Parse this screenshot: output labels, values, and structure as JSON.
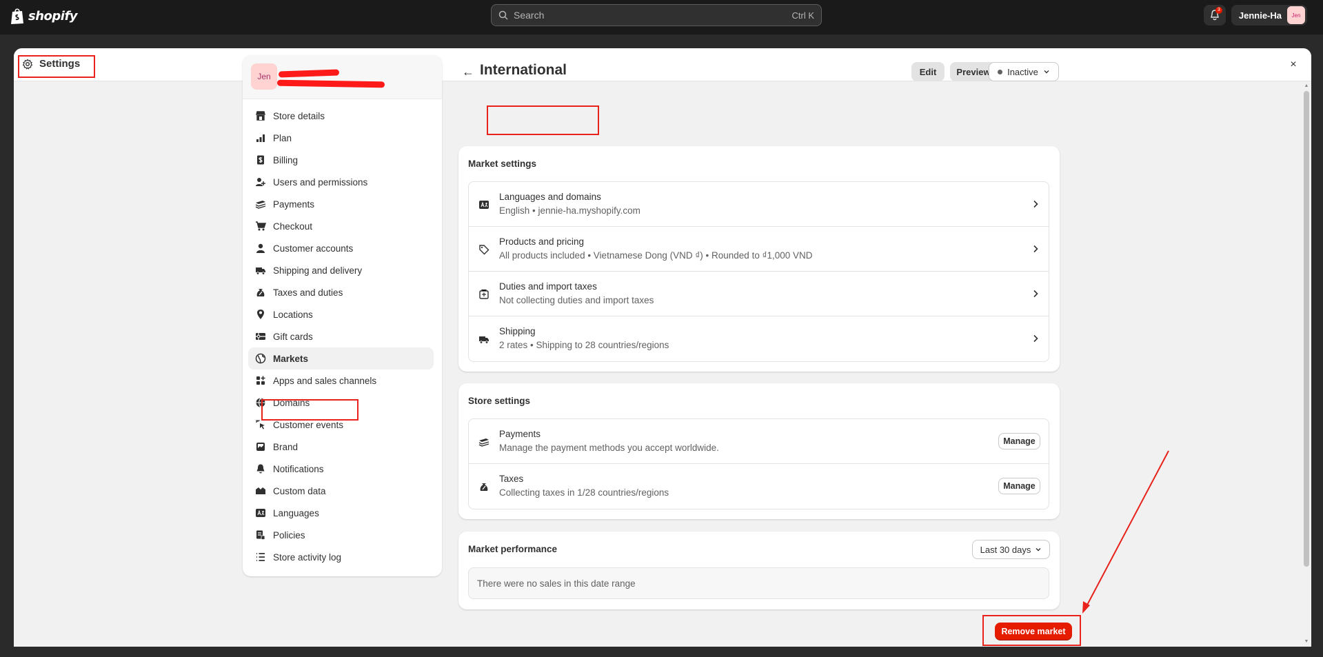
{
  "topbar": {
    "brand": "shopify",
    "search_placeholder": "Search",
    "search_shortcut": "Ctrl K",
    "notification_count": "3",
    "user_name": "Jennie-Ha",
    "user_avatar": "Jen"
  },
  "modal": {
    "title": "Settings",
    "close_label": "×"
  },
  "sidebar": {
    "store_avatar": "Jen",
    "items": [
      {
        "label": "Store details",
        "icon": "store-icon"
      },
      {
        "label": "Plan",
        "icon": "plan-icon"
      },
      {
        "label": "Billing",
        "icon": "billing-icon"
      },
      {
        "label": "Users and permissions",
        "icon": "users-icon"
      },
      {
        "label": "Payments",
        "icon": "payments-icon"
      },
      {
        "label": "Checkout",
        "icon": "cart-icon"
      },
      {
        "label": "Customer accounts",
        "icon": "person-icon"
      },
      {
        "label": "Shipping and delivery",
        "icon": "truck-icon"
      },
      {
        "label": "Taxes and duties",
        "icon": "tax-icon"
      },
      {
        "label": "Locations",
        "icon": "location-icon"
      },
      {
        "label": "Gift cards",
        "icon": "gift-card-icon"
      },
      {
        "label": "Markets",
        "icon": "globe-icon"
      },
      {
        "label": "Apps and sales channels",
        "icon": "apps-icon"
      },
      {
        "label": "Domains",
        "icon": "domains-icon"
      },
      {
        "label": "Customer events",
        "icon": "cursor-icon"
      },
      {
        "label": "Brand",
        "icon": "brand-icon"
      },
      {
        "label": "Notifications",
        "icon": "bell-icon"
      },
      {
        "label": "Custom data",
        "icon": "data-icon"
      },
      {
        "label": "Languages",
        "icon": "language-icon"
      },
      {
        "label": "Policies",
        "icon": "policy-icon"
      },
      {
        "label": "Store activity log",
        "icon": "list-icon"
      }
    ],
    "active": "Markets"
  },
  "page": {
    "title": "International",
    "edit": "Edit",
    "preview": "Preview",
    "status": "Inactive"
  },
  "market_settings": {
    "title": "Market settings",
    "rows": [
      {
        "title": "Languages and domains",
        "detail": "English • jennie-ha.myshopify.com",
        "icon": "language-icon"
      },
      {
        "title": "Products and pricing",
        "detail": "All products included • Vietnamese Dong (VND ₫) • Rounded to ₫1,000 VND",
        "icon": "tag-icon"
      },
      {
        "title": "Duties and import taxes",
        "detail": "Not collecting duties and import taxes",
        "icon": "duties-icon"
      },
      {
        "title": "Shipping",
        "detail": "2 rates • Shipping to 28 countries/regions",
        "icon": "truck-icon"
      }
    ]
  },
  "store_settings": {
    "title": "Store settings",
    "rows": [
      {
        "title": "Payments",
        "detail": "Manage the payment methods you accept worldwide.",
        "action": "Manage",
        "icon": "payments-icon"
      },
      {
        "title": "Taxes",
        "detail": "Collecting taxes in 1/28 countries/regions",
        "action": "Manage",
        "icon": "tax-icon"
      }
    ]
  },
  "performance": {
    "title": "Market performance",
    "range": "Last 30 days",
    "empty": "There were no sales in this date range"
  },
  "remove_button": "Remove market",
  "colors": {
    "critical": "#e51c00",
    "annotation": "#e8211a",
    "topbar": "#1a1a1a"
  }
}
